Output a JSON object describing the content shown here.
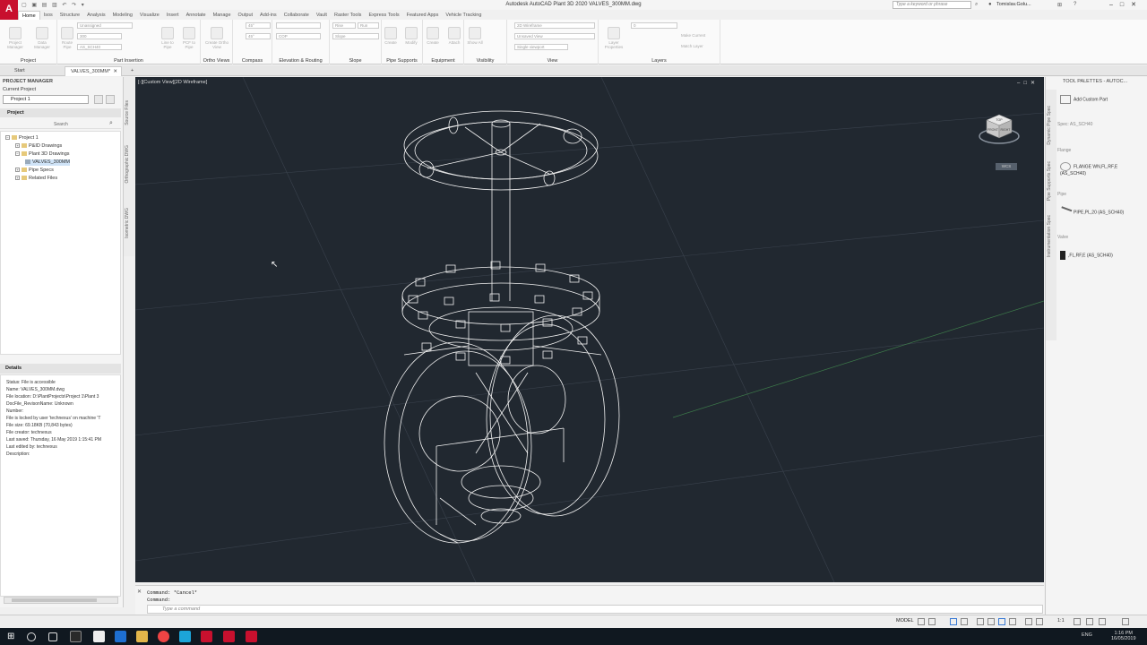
{
  "app": {
    "title": "Autodesk AutoCAD Plant 3D 2020   VALVES_300MM.dwg",
    "app_letter": "A",
    "search_placeholder": "Type a keyword or phrase",
    "user": "Tomislav.Golu..."
  },
  "ribbon": {
    "tabs": [
      "Home",
      "Isos",
      "Structure",
      "Analysis",
      "Modeling",
      "Visualize",
      "Insert",
      "Annotate",
      "Manage",
      "Output",
      "Add-ins",
      "Collaborate",
      "Vault",
      "Raster Tools",
      "Express Tools",
      "Featured Apps",
      "Vehicle Tracking"
    ],
    "active_tab": "Home",
    "groups": [
      "Project",
      "Part Insertion",
      "Ortho Views",
      "Compass",
      "Elevation & Routing",
      "Slope",
      "Pipe Supports",
      "Equipment",
      "Visibility",
      "View",
      "Layers"
    ],
    "buttons": {
      "project_manager": "Project Manager",
      "data_manager": "Data Manager",
      "route_pipe": "Route Pipe",
      "line_to_pipe": "Line to Pipe",
      "pcf_to_pipe": "PCF to Pipe",
      "create_ortho_view": "Create Ortho View",
      "create": "Create",
      "modify": "Modify",
      "attach": "Attach",
      "equipment": "Equipment",
      "show_all": "Show All",
      "layer_properties": "Layer Properties",
      "make_current": "Make Current",
      "match_layer": "Match Layer"
    },
    "combos": {
      "spec_unassigned": "Unassigned",
      "size": "300",
      "spec": "AS_SCH40",
      "angle1": "45°",
      "angle2": "45°",
      "ucs": "COP",
      "rise": "Rise",
      "run": "Run",
      "slope": "Slope",
      "visual_style": "2D Wireframe",
      "view": "Unsaved View",
      "viewports": "Single viewport",
      "layer": "0"
    }
  },
  "file_tabs": {
    "start": "Start",
    "active": "VALVES_300MM*"
  },
  "project_manager": {
    "title": "PROJECT MANAGER",
    "current_project_label": "Current Project",
    "current_project": "Project 1",
    "project_header": "Project",
    "search_label": "Search",
    "tree": [
      {
        "label": "Project 1"
      },
      {
        "label": "P&ID Drawings"
      },
      {
        "label": "Plant 3D Drawings"
      },
      {
        "label": "VALVES_300MM"
      },
      {
        "label": "Pipe Specs"
      },
      {
        "label": "Related Files"
      }
    ],
    "vtabs": [
      "Source Files",
      "Orthographic DWG",
      "Isometric DWG"
    ]
  },
  "details": {
    "header": "Details",
    "lines": [
      "Status: File is accessible",
      "Name: VALVES_300MM.dwg",
      "File location: D:\\PlantProjects\\Project 1\\Plant 3",
      "DocFile_RevisonName: Unknown",
      "Number:",
      "File is locked by user 'technexus' on machine 'T",
      "File size: 69.18KB (70,843 bytes)",
      "File creator: technexus",
      "Last saved: Thursday, 16 May 2019 1:15:41 PM",
      "Last edited by: technexus",
      "Description:"
    ]
  },
  "viewport": {
    "label": "[-][Custom View][2D Wireframe]",
    "viewcube_top": "TOP",
    "viewcube_front": "FRONT",
    "viewcube_right": "RIGHT",
    "wcs": "WCS",
    "background": "#212830",
    "line_color": "#f2f2f2"
  },
  "command": {
    "history1": "Command: *Cancel*",
    "history2": "Command:",
    "placeholder": "Type a command"
  },
  "tool_palettes": {
    "title": "TOOL PALETTES - AUTOC...",
    "add_custom_part": "Add Custom Part",
    "spec": "Spec: AS_SCH40",
    "sections": [
      {
        "name": "Flange",
        "item": "FLANGE WN,FL,RF,E (AS_SCH40)"
      },
      {
        "name": "Pipe",
        "item": "PIPE,PL,20 (AS_SCH40)"
      },
      {
        "name": "Valve",
        "item": ",FL,RF,E (AS_SCH40)"
      }
    ],
    "vtabs": [
      "Dynamic Pipe Spec",
      "Pipe Supports Spec",
      "Instrumentation Spec"
    ]
  },
  "statusbar": {
    "model": "MODEL",
    "scale": "1:1"
  },
  "taskbar": {
    "lang": "ENG",
    "time": "1:16 PM",
    "date": "16/05/2019"
  }
}
